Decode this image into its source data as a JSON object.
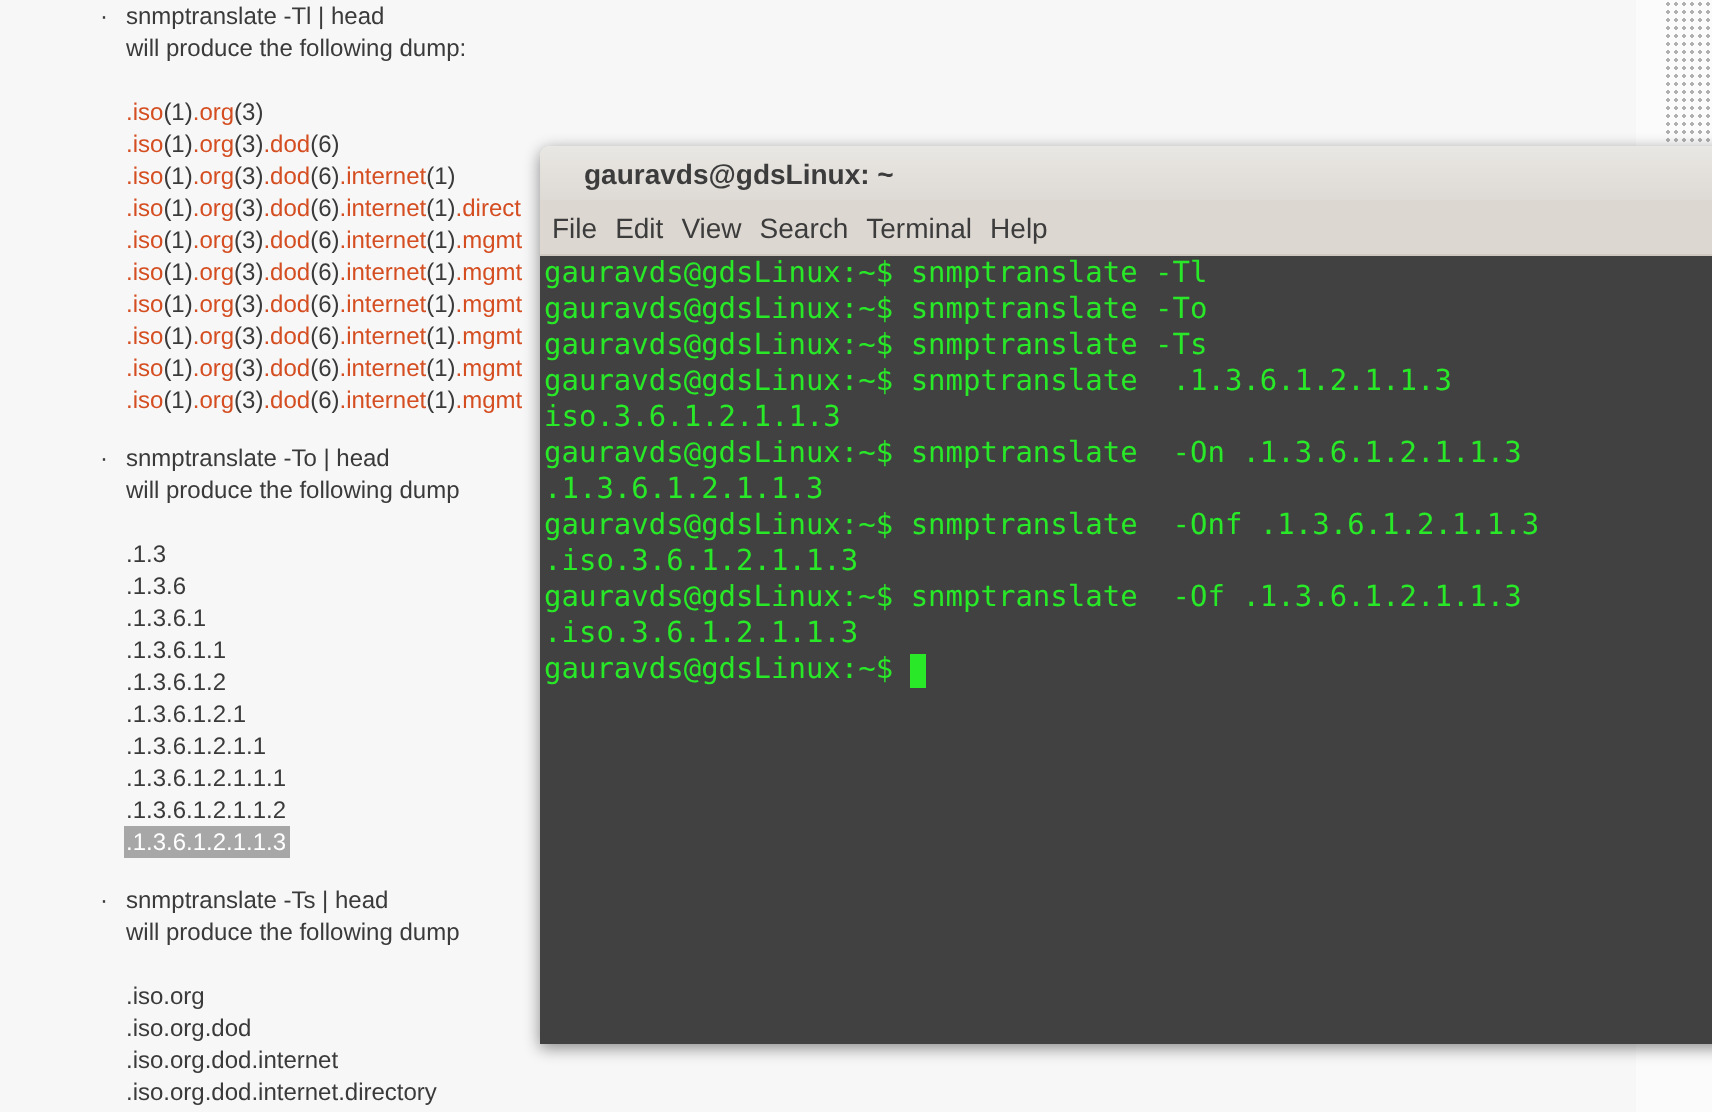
{
  "page": {
    "sections": [
      {
        "bullet": "·",
        "command": "snmptranslate -Tl | head",
        "caption": "will produce the following dump:",
        "dump": [
          [
            {
              "kind": "name",
              "text": ".iso"
            },
            {
              "kind": "plain",
              "text": "(1)"
            },
            {
              "kind": "name",
              "text": ".org"
            },
            {
              "kind": "plain",
              "text": "(3)"
            }
          ],
          [
            {
              "kind": "name",
              "text": ".iso"
            },
            {
              "kind": "plain",
              "text": "(1)"
            },
            {
              "kind": "name",
              "text": ".org"
            },
            {
              "kind": "plain",
              "text": "(3)"
            },
            {
              "kind": "name",
              "text": ".dod"
            },
            {
              "kind": "plain",
              "text": "(6)"
            }
          ],
          [
            {
              "kind": "name",
              "text": ".iso"
            },
            {
              "kind": "plain",
              "text": "(1)"
            },
            {
              "kind": "name",
              "text": ".org"
            },
            {
              "kind": "plain",
              "text": "(3)"
            },
            {
              "kind": "name",
              "text": ".dod"
            },
            {
              "kind": "plain",
              "text": "(6)"
            },
            {
              "kind": "name",
              "text": ".internet"
            },
            {
              "kind": "plain",
              "text": "(1)"
            }
          ],
          [
            {
              "kind": "name",
              "text": ".iso"
            },
            {
              "kind": "plain",
              "text": "(1)"
            },
            {
              "kind": "name",
              "text": ".org"
            },
            {
              "kind": "plain",
              "text": "(3)"
            },
            {
              "kind": "name",
              "text": ".dod"
            },
            {
              "kind": "plain",
              "text": "(6)"
            },
            {
              "kind": "name",
              "text": ".internet"
            },
            {
              "kind": "plain",
              "text": "(1)"
            },
            {
              "kind": "name",
              "text": ".direct"
            }
          ],
          [
            {
              "kind": "name",
              "text": ".iso"
            },
            {
              "kind": "plain",
              "text": "(1)"
            },
            {
              "kind": "name",
              "text": ".org"
            },
            {
              "kind": "plain",
              "text": "(3)"
            },
            {
              "kind": "name",
              "text": ".dod"
            },
            {
              "kind": "plain",
              "text": "(6)"
            },
            {
              "kind": "name",
              "text": ".internet"
            },
            {
              "kind": "plain",
              "text": "(1)"
            },
            {
              "kind": "name",
              "text": ".mgmt"
            }
          ],
          [
            {
              "kind": "name",
              "text": ".iso"
            },
            {
              "kind": "plain",
              "text": "(1)"
            },
            {
              "kind": "name",
              "text": ".org"
            },
            {
              "kind": "plain",
              "text": "(3)"
            },
            {
              "kind": "name",
              "text": ".dod"
            },
            {
              "kind": "plain",
              "text": "(6)"
            },
            {
              "kind": "name",
              "text": ".internet"
            },
            {
              "kind": "plain",
              "text": "(1)"
            },
            {
              "kind": "name",
              "text": ".mgmt"
            }
          ],
          [
            {
              "kind": "name",
              "text": ".iso"
            },
            {
              "kind": "plain",
              "text": "(1)"
            },
            {
              "kind": "name",
              "text": ".org"
            },
            {
              "kind": "plain",
              "text": "(3)"
            },
            {
              "kind": "name",
              "text": ".dod"
            },
            {
              "kind": "plain",
              "text": "(6)"
            },
            {
              "kind": "name",
              "text": ".internet"
            },
            {
              "kind": "plain",
              "text": "(1)"
            },
            {
              "kind": "name",
              "text": ".mgmt"
            }
          ],
          [
            {
              "kind": "name",
              "text": ".iso"
            },
            {
              "kind": "plain",
              "text": "(1)"
            },
            {
              "kind": "name",
              "text": ".org"
            },
            {
              "kind": "plain",
              "text": "(3)"
            },
            {
              "kind": "name",
              "text": ".dod"
            },
            {
              "kind": "plain",
              "text": "(6)"
            },
            {
              "kind": "name",
              "text": ".internet"
            },
            {
              "kind": "plain",
              "text": "(1)"
            },
            {
              "kind": "name",
              "text": ".mgmt"
            }
          ],
          [
            {
              "kind": "name",
              "text": ".iso"
            },
            {
              "kind": "plain",
              "text": "(1)"
            },
            {
              "kind": "name",
              "text": ".org"
            },
            {
              "kind": "plain",
              "text": "(3)"
            },
            {
              "kind": "name",
              "text": ".dod"
            },
            {
              "kind": "plain",
              "text": "(6)"
            },
            {
              "kind": "name",
              "text": ".internet"
            },
            {
              "kind": "plain",
              "text": "(1)"
            },
            {
              "kind": "name",
              "text": ".mgmt"
            }
          ],
          [
            {
              "kind": "name",
              "text": ".iso"
            },
            {
              "kind": "plain",
              "text": "(1)"
            },
            {
              "kind": "name",
              "text": ".org"
            },
            {
              "kind": "plain",
              "text": "(3)"
            },
            {
              "kind": "name",
              "text": ".dod"
            },
            {
              "kind": "plain",
              "text": "(6)"
            },
            {
              "kind": "name",
              "text": ".internet"
            },
            {
              "kind": "plain",
              "text": "(1)"
            },
            {
              "kind": "name",
              "text": ".mgmt"
            }
          ]
        ]
      },
      {
        "bullet": "·",
        "command": "snmptranslate -To | head",
        "caption": "will produce the following dump",
        "dump": [
          [
            {
              "kind": "plain",
              "text": ".1.3"
            }
          ],
          [
            {
              "kind": "plain",
              "text": ".1.3.6"
            }
          ],
          [
            {
              "kind": "plain",
              "text": ".1.3.6.1"
            }
          ],
          [
            {
              "kind": "plain",
              "text": ".1.3.6.1.1"
            }
          ],
          [
            {
              "kind": "plain",
              "text": ".1.3.6.1.2"
            }
          ],
          [
            {
              "kind": "plain",
              "text": ".1.3.6.1.2.1"
            }
          ],
          [
            {
              "kind": "plain",
              "text": ".1.3.6.1.2.1.1"
            }
          ],
          [
            {
              "kind": "plain",
              "text": ".1.3.6.1.2.1.1.1"
            }
          ],
          [
            {
              "kind": "plain",
              "text": ".1.3.6.1.2.1.1.2"
            }
          ],
          [
            {
              "kind": "selected",
              "text": ".1.3.6.1.2.1.1.3"
            }
          ]
        ]
      },
      {
        "bullet": "·",
        "command": "snmptranslate -Ts | head",
        "caption": "will produce the following dump",
        "dump": [
          [
            {
              "kind": "plain",
              "text": ".iso.org"
            }
          ],
          [
            {
              "kind": "plain",
              "text": ".iso.org.dod"
            }
          ],
          [
            {
              "kind": "plain",
              "text": ".iso.org.dod.internet"
            }
          ],
          [
            {
              "kind": "plain",
              "text": ".iso.org.dod.internet.directory"
            }
          ]
        ]
      }
    ]
  },
  "terminal": {
    "title": "gauravds@gdsLinux: ~",
    "menu": [
      "File",
      "Edit",
      "View",
      "Search",
      "Terminal",
      "Help"
    ],
    "lines": [
      "gauravds@gdsLinux:~$ snmptranslate -Tl",
      "gauravds@gdsLinux:~$ snmptranslate -To",
      "gauravds@gdsLinux:~$ snmptranslate -Ts",
      "gauravds@gdsLinux:~$ snmptranslate  .1.3.6.1.2.1.1.3",
      "iso.3.6.1.2.1.1.3",
      "gauravds@gdsLinux:~$ snmptranslate  -On .1.3.6.1.2.1.1.3",
      ".1.3.6.1.2.1.1.3",
      "gauravds@gdsLinux:~$ snmptranslate  -Onf .1.3.6.1.2.1.1.3",
      ".iso.3.6.1.2.1.1.3",
      "gauravds@gdsLinux:~$ snmptranslate  -Of .1.3.6.1.2.1.1.3",
      ".iso.3.6.1.2.1.1.3"
    ],
    "prompt": "gauravds@gdsLinux:~$ "
  }
}
